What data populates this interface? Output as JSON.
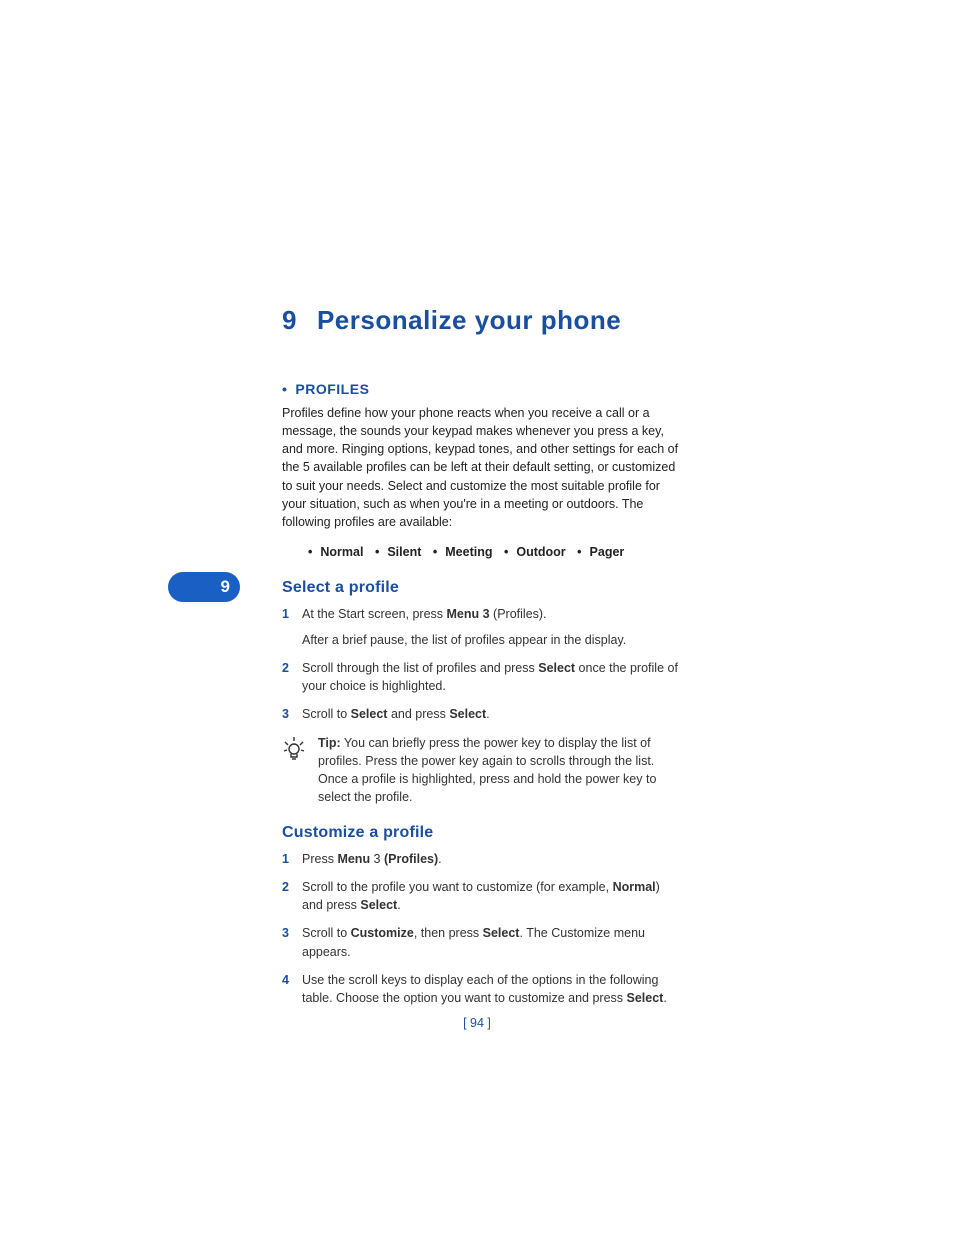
{
  "chapter": {
    "number": "9",
    "title": "Personalize your phone"
  },
  "side_tab": "9",
  "section1": {
    "bullet": "•",
    "heading": "PROFILES",
    "paragraph": "Profiles define how your phone reacts when you receive a call or a message, the sounds your keypad makes whenever you press a key, and more. Ringing options, keypad tones, and other settings for each of the 5 available profiles can be left at their default setting, or customized to suit your needs. Select and customize the most suitable profile for your situation, such as when you're in a meeting or outdoors. The following profiles are available:",
    "profiles": [
      "Normal",
      "Silent",
      "Meeting",
      "Outdoor",
      "Pager"
    ]
  },
  "sub1": {
    "heading": "Select a profile",
    "step1": {
      "num": "1",
      "pre": "At the Start screen, press ",
      "bold": "Menu 3",
      "post": " (Profiles).",
      "followup": "After a brief pause, the list of profiles appear in the display."
    },
    "step2": {
      "num": "2",
      "pre": "Scroll through the list of profiles and press ",
      "bold": "Select",
      "post": " once the profile of your choice is highlighted."
    },
    "step3": {
      "num": "3",
      "pre": "Scroll to ",
      "bold1": "Select",
      "mid": " and press ",
      "bold2": "Select",
      "end": "."
    },
    "tip": {
      "label": "Tip:",
      "text": " You can briefly press the power key to display the list of profiles. Press the power key again to scrolls through the list. Once a profile is highlighted, press and hold the power key to select the profile."
    }
  },
  "sub2": {
    "heading": "Customize a profile",
    "step1": {
      "num": "1",
      "pre": "Press ",
      "bold1": "Menu",
      "mid": " 3 ",
      "bold2": "(Profiles)",
      "end": "."
    },
    "step2": {
      "num": "2",
      "pre": "Scroll to the profile you want to customize (for example, ",
      "bold1": "Normal",
      "mid": ") and press ",
      "bold2": "Select",
      "end": "."
    },
    "step3": {
      "num": "3",
      "pre": "Scroll to ",
      "bold1": "Customize",
      "mid": ", then press ",
      "bold2": "Select",
      "end": ". The Customize menu appears."
    },
    "step4": {
      "num": "4",
      "pre": "Use the scroll keys to display each of the options in the following table. Choose the option you want to customize and press ",
      "bold": "Select",
      "end": "."
    }
  },
  "page_number": "[ 94 ]"
}
